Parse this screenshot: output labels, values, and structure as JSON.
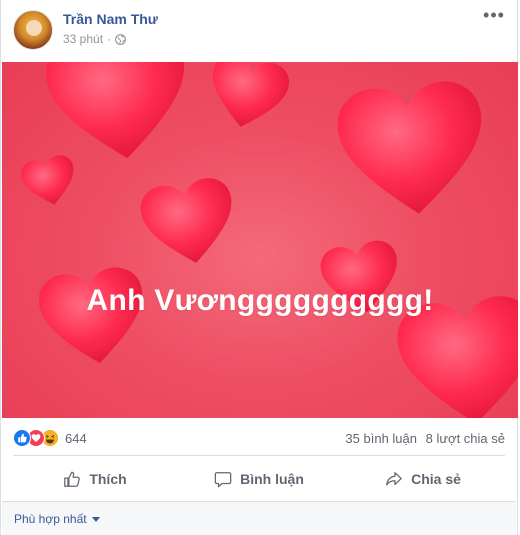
{
  "post": {
    "author": "Trần Nam Thư",
    "time": "33 phút",
    "separator": "·",
    "photo_text": "Anh Vươngggggggggg!"
  },
  "stats": {
    "reaction_count": "644",
    "comments": "35 bình luận",
    "shares": "8 lượt chia sẻ"
  },
  "actions": {
    "like": "Thích",
    "comment": "Bình luận",
    "share": "Chia sẻ"
  },
  "comments": {
    "sort_label": "Phù hợp nhất"
  },
  "colors": {
    "link": "#385898",
    "photo_bg": "#ee4e64",
    "heart": "#ff2d55",
    "like_blue": "#1877f2",
    "love_red": "#f33e58",
    "haha_yellow": "#f7b125"
  },
  "icons": {
    "privacy": "globe-icon",
    "menu": "more-options-icon",
    "like": "thumbs-up-icon",
    "comment": "speech-bubble-icon",
    "share": "share-arrow-icon"
  }
}
